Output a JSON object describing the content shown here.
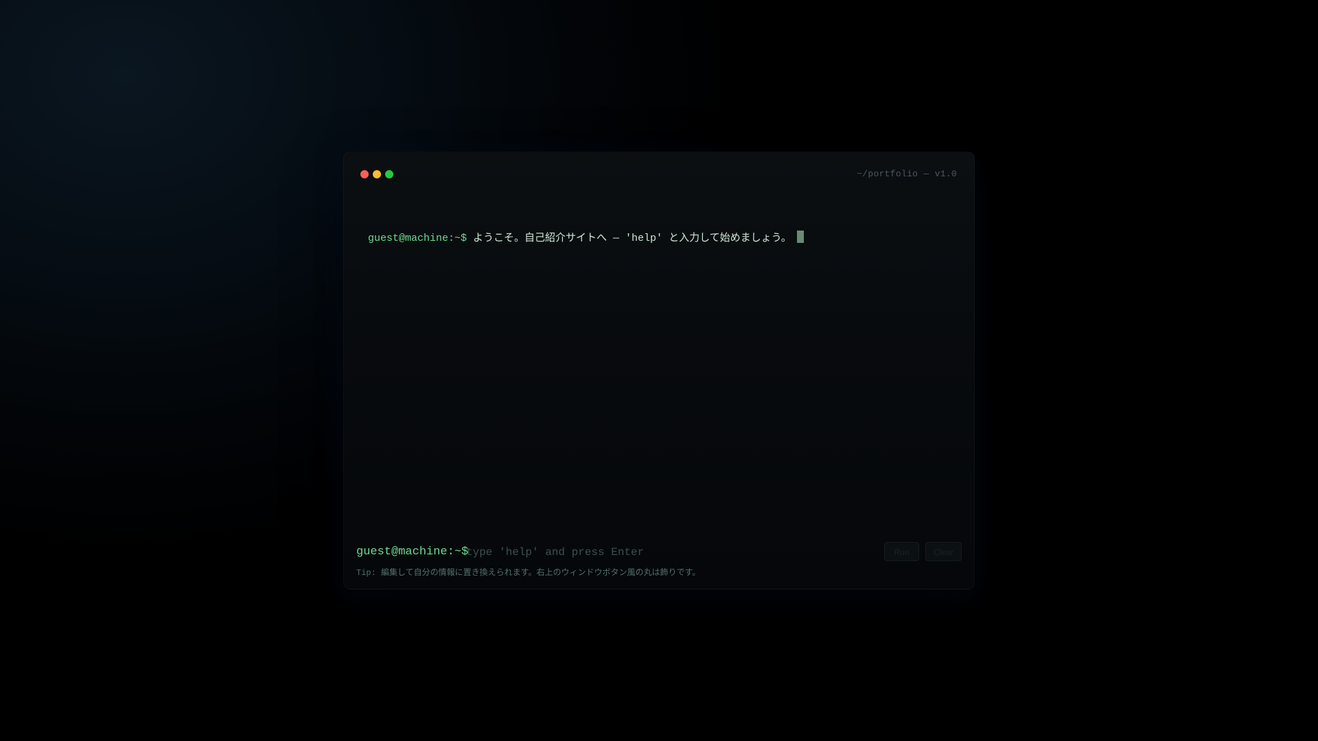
{
  "window": {
    "title": "~/portfolio — v1.0",
    "controls": [
      "red",
      "yellow",
      "green"
    ]
  },
  "output": {
    "lines": [
      {
        "prompt": "guest@machine:~$",
        "text": "ようこそ。自己紹介サイトへ — 'help' と入力して始めましょう。"
      }
    ]
  },
  "input": {
    "prompt": "guest@machine:~$",
    "placeholder": "type 'help' and press Enter",
    "value": ""
  },
  "buttons": {
    "run_label": "Run",
    "clear_label": "Clear"
  },
  "tip": "Tip: 編集して自分の情報に置き換えられます。右上のウィンドウボタン風の丸は飾りです。",
  "colors": {
    "prompt": "#6ddc8f",
    "dot_red": "#ff5f57",
    "dot_yellow": "#febc2e",
    "dot_green": "#28c840"
  }
}
